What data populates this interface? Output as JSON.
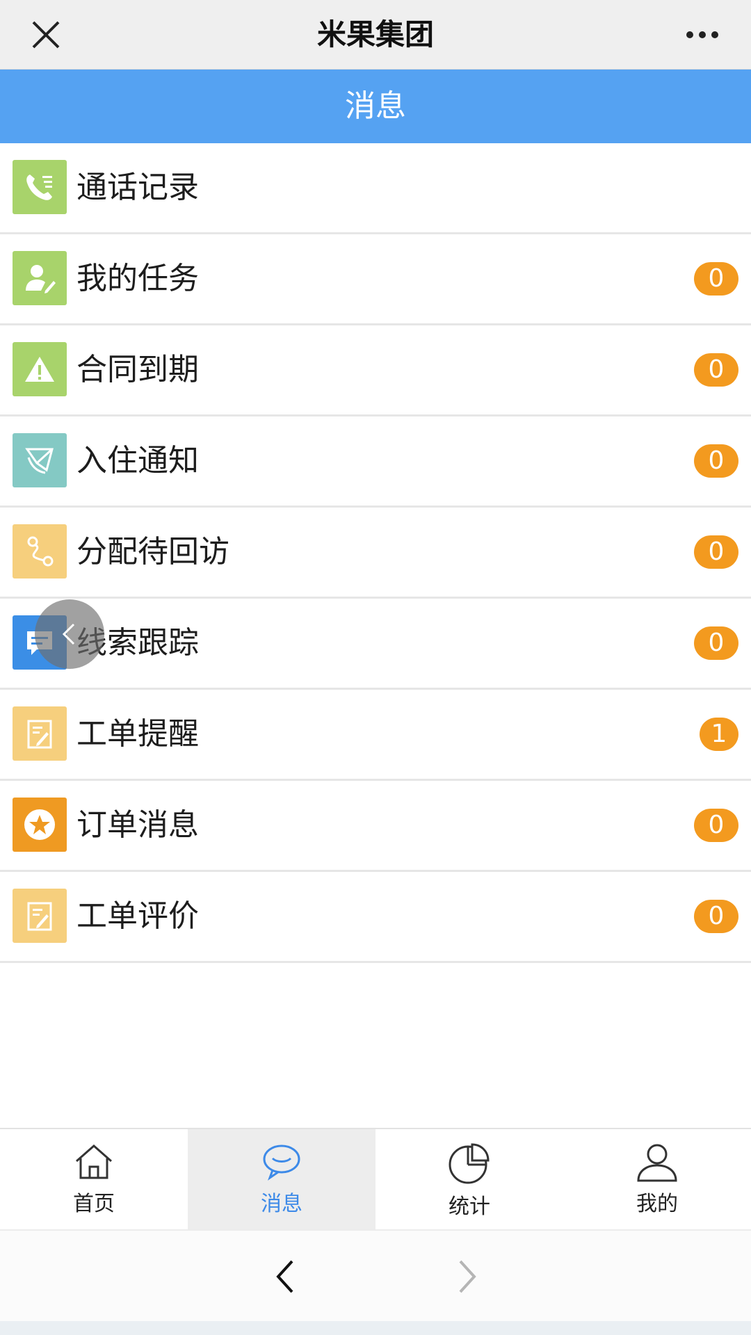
{
  "topbar": {
    "title": "米果集团"
  },
  "header": {
    "title": "消息"
  },
  "list": {
    "items": [
      {
        "label": "通话记录",
        "badge": ""
      },
      {
        "label": "我的任务",
        "badge": "0"
      },
      {
        "label": "合同到期",
        "badge": "0"
      },
      {
        "label": "入住通知",
        "badge": "0"
      },
      {
        "label": "分配待回访",
        "badge": "0"
      },
      {
        "label": "线索跟踪",
        "badge": "0"
      },
      {
        "label": "工单提醒",
        "badge": "1"
      },
      {
        "label": "订单消息",
        "badge": "0"
      },
      {
        "label": "工单评价",
        "badge": "0"
      }
    ]
  },
  "tabs": [
    {
      "label": "首页",
      "icon": "home-icon"
    },
    {
      "label": "消息",
      "icon": "chat-icon",
      "active": true
    },
    {
      "label": "统计",
      "icon": "pie-chart-icon"
    },
    {
      "label": "我的",
      "icon": "user-icon"
    }
  ],
  "colors": {
    "header_blue": "#55a2f2",
    "badge_orange": "#f39a1f",
    "icon_green": "#a8d36b",
    "icon_teal": "#84c9c4",
    "icon_yellow": "#f6cf7d",
    "icon_blue": "#3b8ee6",
    "icon_orange": "#ef9a22",
    "active_tab_text": "#3d8ae8"
  }
}
